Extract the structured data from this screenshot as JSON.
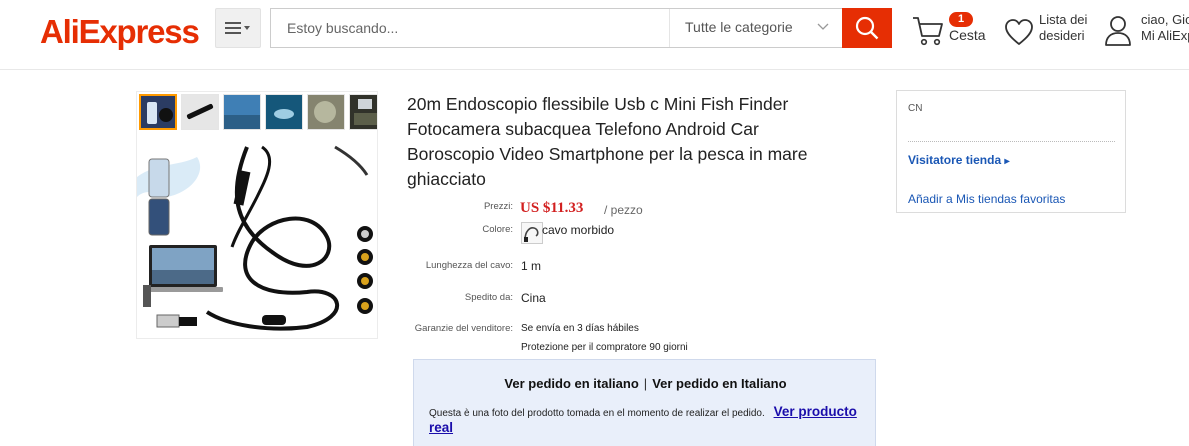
{
  "header": {
    "logo": "AliExpress",
    "search_placeholder": "Estoy buscando...",
    "category": "Tutte le categorie",
    "cart_count": "1",
    "cart_label": "Cesta",
    "wishlist_line1": "Lista dei",
    "wishlist_line2": "desideri",
    "account_line1": "ciao, Gio",
    "account_line2": "Mi AliExp"
  },
  "product": {
    "title": "20m Endoscopio flessibile Usb c Mini Fish Finder Fotocamera subacquea Telefono Android Car Boroscopio Video Smartphone per la pesca in mare ghiacciato",
    "price_label": "Prezzi:",
    "price": "US $11.33",
    "price_unit": "/ pezzo",
    "color_label": "Colore:",
    "color_value": "cavo morbido",
    "cable_label": "Lunghezza del cavo:",
    "cable_value": "1 m",
    "ship_label": "Spedito da:",
    "ship_value": "Cina",
    "guarantee_label": "Garanzie del venditore:",
    "guarantee_line1": "Se envía en 3 días hábiles",
    "guarantee_line2": "Protezione per il compratore 90 giorni"
  },
  "translation": {
    "option_a": "Ver pedido en italiano",
    "separator": "|",
    "option_b": "Ver pedido en Italiano",
    "note": "Questa è una foto del prodotto tomada en el momento de realizar el pedido.",
    "link": "Ver producto real"
  },
  "store": {
    "country": "CN",
    "visit": "Visitatore tienda",
    "visit_arrow": "▸",
    "favorite": "Añadir a Mis tiendas favoritas"
  },
  "colors": {
    "brand": "#e62e04",
    "price": "#d21f1f",
    "link": "#1a57b5"
  }
}
